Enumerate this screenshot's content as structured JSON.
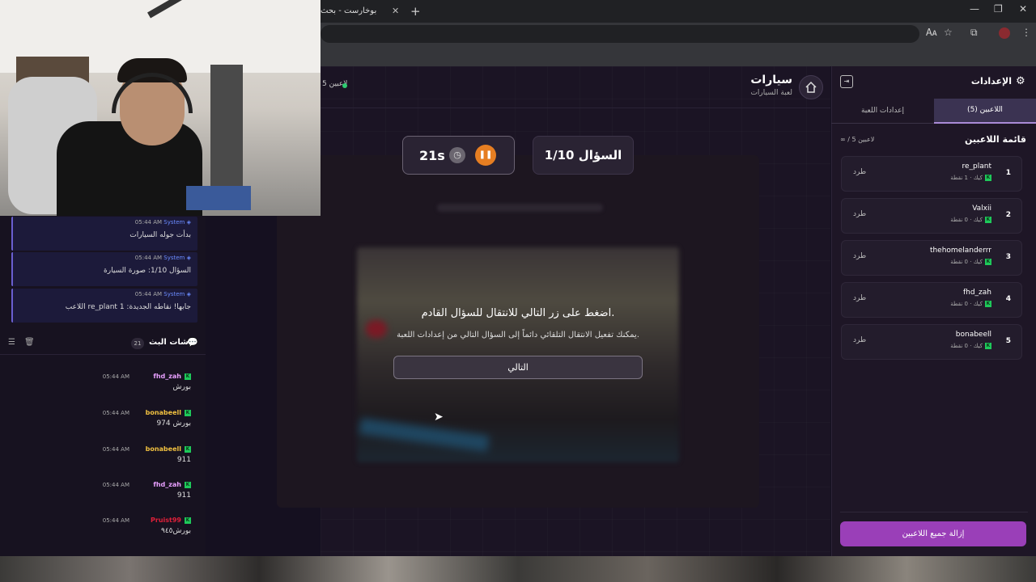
{
  "browser": {
    "tab_title": "بوخارست - بحث Google",
    "tab_close": "✕",
    "new_tab": "+",
    "min": "—",
    "restore": "❐",
    "close": "✕",
    "translate_icon": "🗛",
    "star_icon": "☆",
    "ext_icon": "⧉",
    "menu_icon": "⋮"
  },
  "game": {
    "title": "سيارات",
    "subtitle": "لعبة السيارات",
    "players_online": "5 لاعبين",
    "question": "السؤال 1/10",
    "timer": "21s",
    "overlay_title": "اضغط على زر التالي للانتقال للسؤال القادم.",
    "overlay_hint": "يمكنك تفعيل الانتقال التلقائي دائماً إلى السؤال التالي من إعدادات اللعبة.",
    "next_label": "التالي"
  },
  "system_messages": [
    {
      "name": "System",
      "time": "05:44 AM",
      "text": "بدأت جوله السيارات"
    },
    {
      "name": "System",
      "time": "05:44 AM",
      "text": "السؤال 1/10: صورة السيارة"
    },
    {
      "name": "System",
      "time": "05:44 AM",
      "text": "اللاعب re_plant جابها! نقاطه الجديدة: 1"
    }
  ],
  "chat": {
    "title": "شات البث",
    "count": "21",
    "messages": [
      {
        "user": "fhd_zah",
        "time": "05:44 AM",
        "text": "بورش",
        "color": "#e8a0ff"
      },
      {
        "user": "bonabeell",
        "time": "05:44 AM",
        "text": "بورش 974",
        "color": "#f0c040"
      },
      {
        "user": "bonabeell",
        "time": "05:44 AM",
        "text": "911",
        "color": "#f0c040"
      },
      {
        "user": "fhd_zah",
        "time": "05:44 AM",
        "text": "911",
        "color": "#e8a0ff"
      },
      {
        "user": "Pruist99",
        "time": "05:44 AM",
        "text": "بورش٩٤٥",
        "color": "#e0203a"
      }
    ]
  },
  "settings_panel": {
    "title": "الإعدادات",
    "tab_players": "اللاعبين (5)",
    "tab_game_settings": "إعدادات اللعبة",
    "players_list_title": "قائمة اللاعبين",
    "players_limit": "∞ / 5 لاعبين",
    "kick_label": "طرد",
    "remove_all": "إزالة جميع اللاعبين",
    "players": [
      {
        "rank": "1",
        "name": "re_plant",
        "meta": "كيك · 1 نقطة"
      },
      {
        "rank": "2",
        "name": "Valxii",
        "meta": "كيك · 0 نقطة"
      },
      {
        "rank": "3",
        "name": "thehomelanderrr",
        "meta": "كيك · 0 نقطة"
      },
      {
        "rank": "4",
        "name": "fhd_zah",
        "meta": "كيك · 0 نقطة"
      },
      {
        "rank": "5",
        "name": "bonabeell",
        "meta": "كيك · 0 نقطة"
      }
    ]
  },
  "colors": {
    "accent": "#9a3fb8",
    "pause": "#e67e22",
    "online": "#2ecc71",
    "kick_badge": "#1ec95a"
  }
}
